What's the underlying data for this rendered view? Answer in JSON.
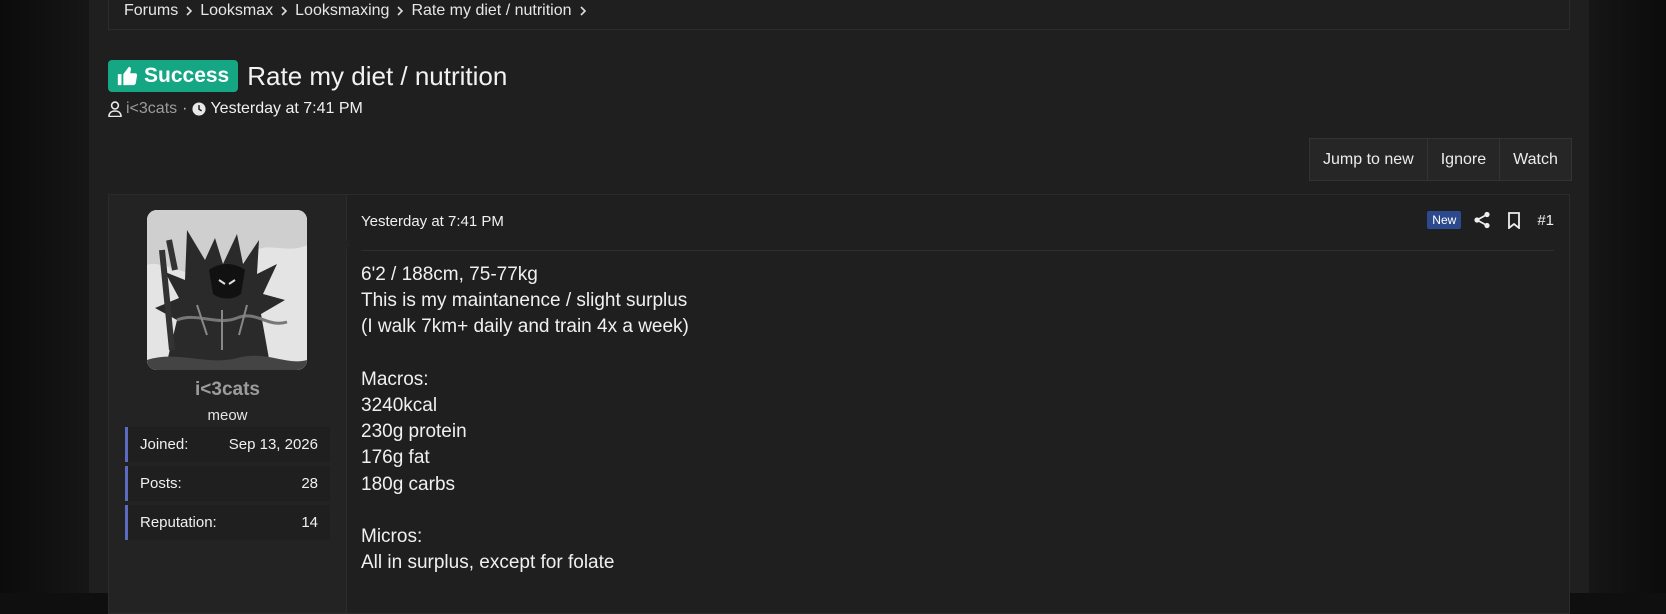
{
  "breadcrumb": [
    "Forums",
    "Looksmax",
    "Looksmaxing",
    "Rate my diet / nutrition"
  ],
  "thread": {
    "prefix": "Success",
    "title": "Rate my diet / nutrition",
    "author": "i<3cats",
    "separator": "·",
    "time": "Yesterday at 7:41 PM"
  },
  "actions": [
    "Jump to new",
    "Ignore",
    "Watch"
  ],
  "user": {
    "name": "i<3cats",
    "title": "meow",
    "stats": [
      {
        "label": "Joined:",
        "value": "Sep 13, 2026"
      },
      {
        "label": "Posts:",
        "value": "28"
      },
      {
        "label": "Reputation:",
        "value": "14"
      }
    ]
  },
  "post": {
    "date": "Yesterday at 7:41 PM",
    "new_label": "New",
    "number": "#1",
    "lines": [
      "6'2 / 188cm, 75-77kg",
      "This is my maintanence / slight surplus",
      "(I walk 7km+ daily and train 4x a week)",
      "",
      "Macros:",
      "3240kcal",
      "230g protein",
      "176g fat",
      "180g carbs",
      "",
      "Micros:",
      "All in surplus, except for folate"
    ]
  },
  "colors": {
    "prefix_bg": "#15a683",
    "new_bg": "#2b4a8e",
    "stat_accent": "#5b6bc0"
  },
  "icons": [
    "chevron-right-icon",
    "thumbs-up-icon",
    "user-icon",
    "clock-icon",
    "share-icon",
    "bookmark-icon"
  ]
}
